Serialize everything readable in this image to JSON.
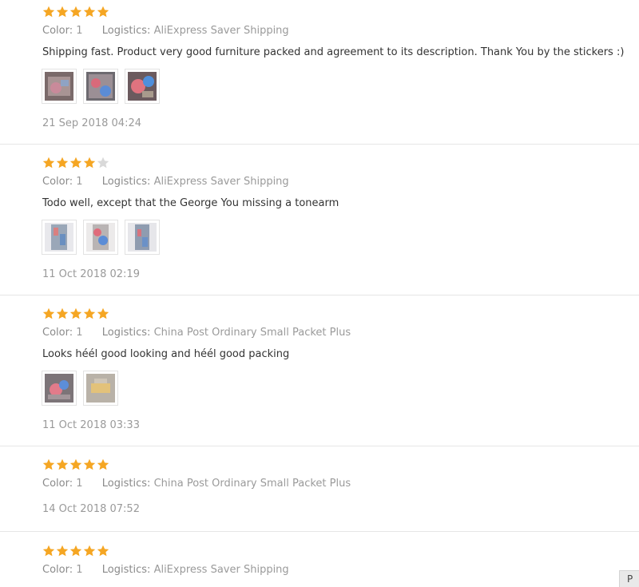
{
  "labels": {
    "color": "Color:",
    "logistics": "Logistics:"
  },
  "star_colors": {
    "filled": "#f5a623",
    "empty": "#d9d9d9"
  },
  "reviews": [
    {
      "rating": 5,
      "color": "1",
      "logistics": "AliExpress Saver Shipping",
      "text": "Shipping fast. Product very good furniture packed and agreement to its description. Thank You by the stickers :)",
      "photo_count": 3,
      "date": "21 Sep 2018 04:24"
    },
    {
      "rating": 4,
      "color": "1",
      "logistics": "AliExpress Saver Shipping",
      "text": "Todo well, except that the George You missing a tonearm",
      "photo_count": 3,
      "date": "11 Oct 2018 02:19"
    },
    {
      "rating": 5,
      "color": "1",
      "logistics": "China Post Ordinary Small Packet Plus",
      "text": "Looks héél good looking and héél good packing",
      "photo_count": 2,
      "date": "11 Oct 2018 03:33"
    },
    {
      "rating": 5,
      "color": "1",
      "logistics": "China Post Ordinary Small Packet Plus",
      "text": "",
      "photo_count": 0,
      "date": "14 Oct 2018 07:52"
    },
    {
      "rating": 5,
      "color": "1",
      "logistics": "AliExpress Saver Shipping",
      "text": "",
      "photo_count": 0,
      "date": ""
    }
  ],
  "corner_button": {
    "label": "P"
  }
}
